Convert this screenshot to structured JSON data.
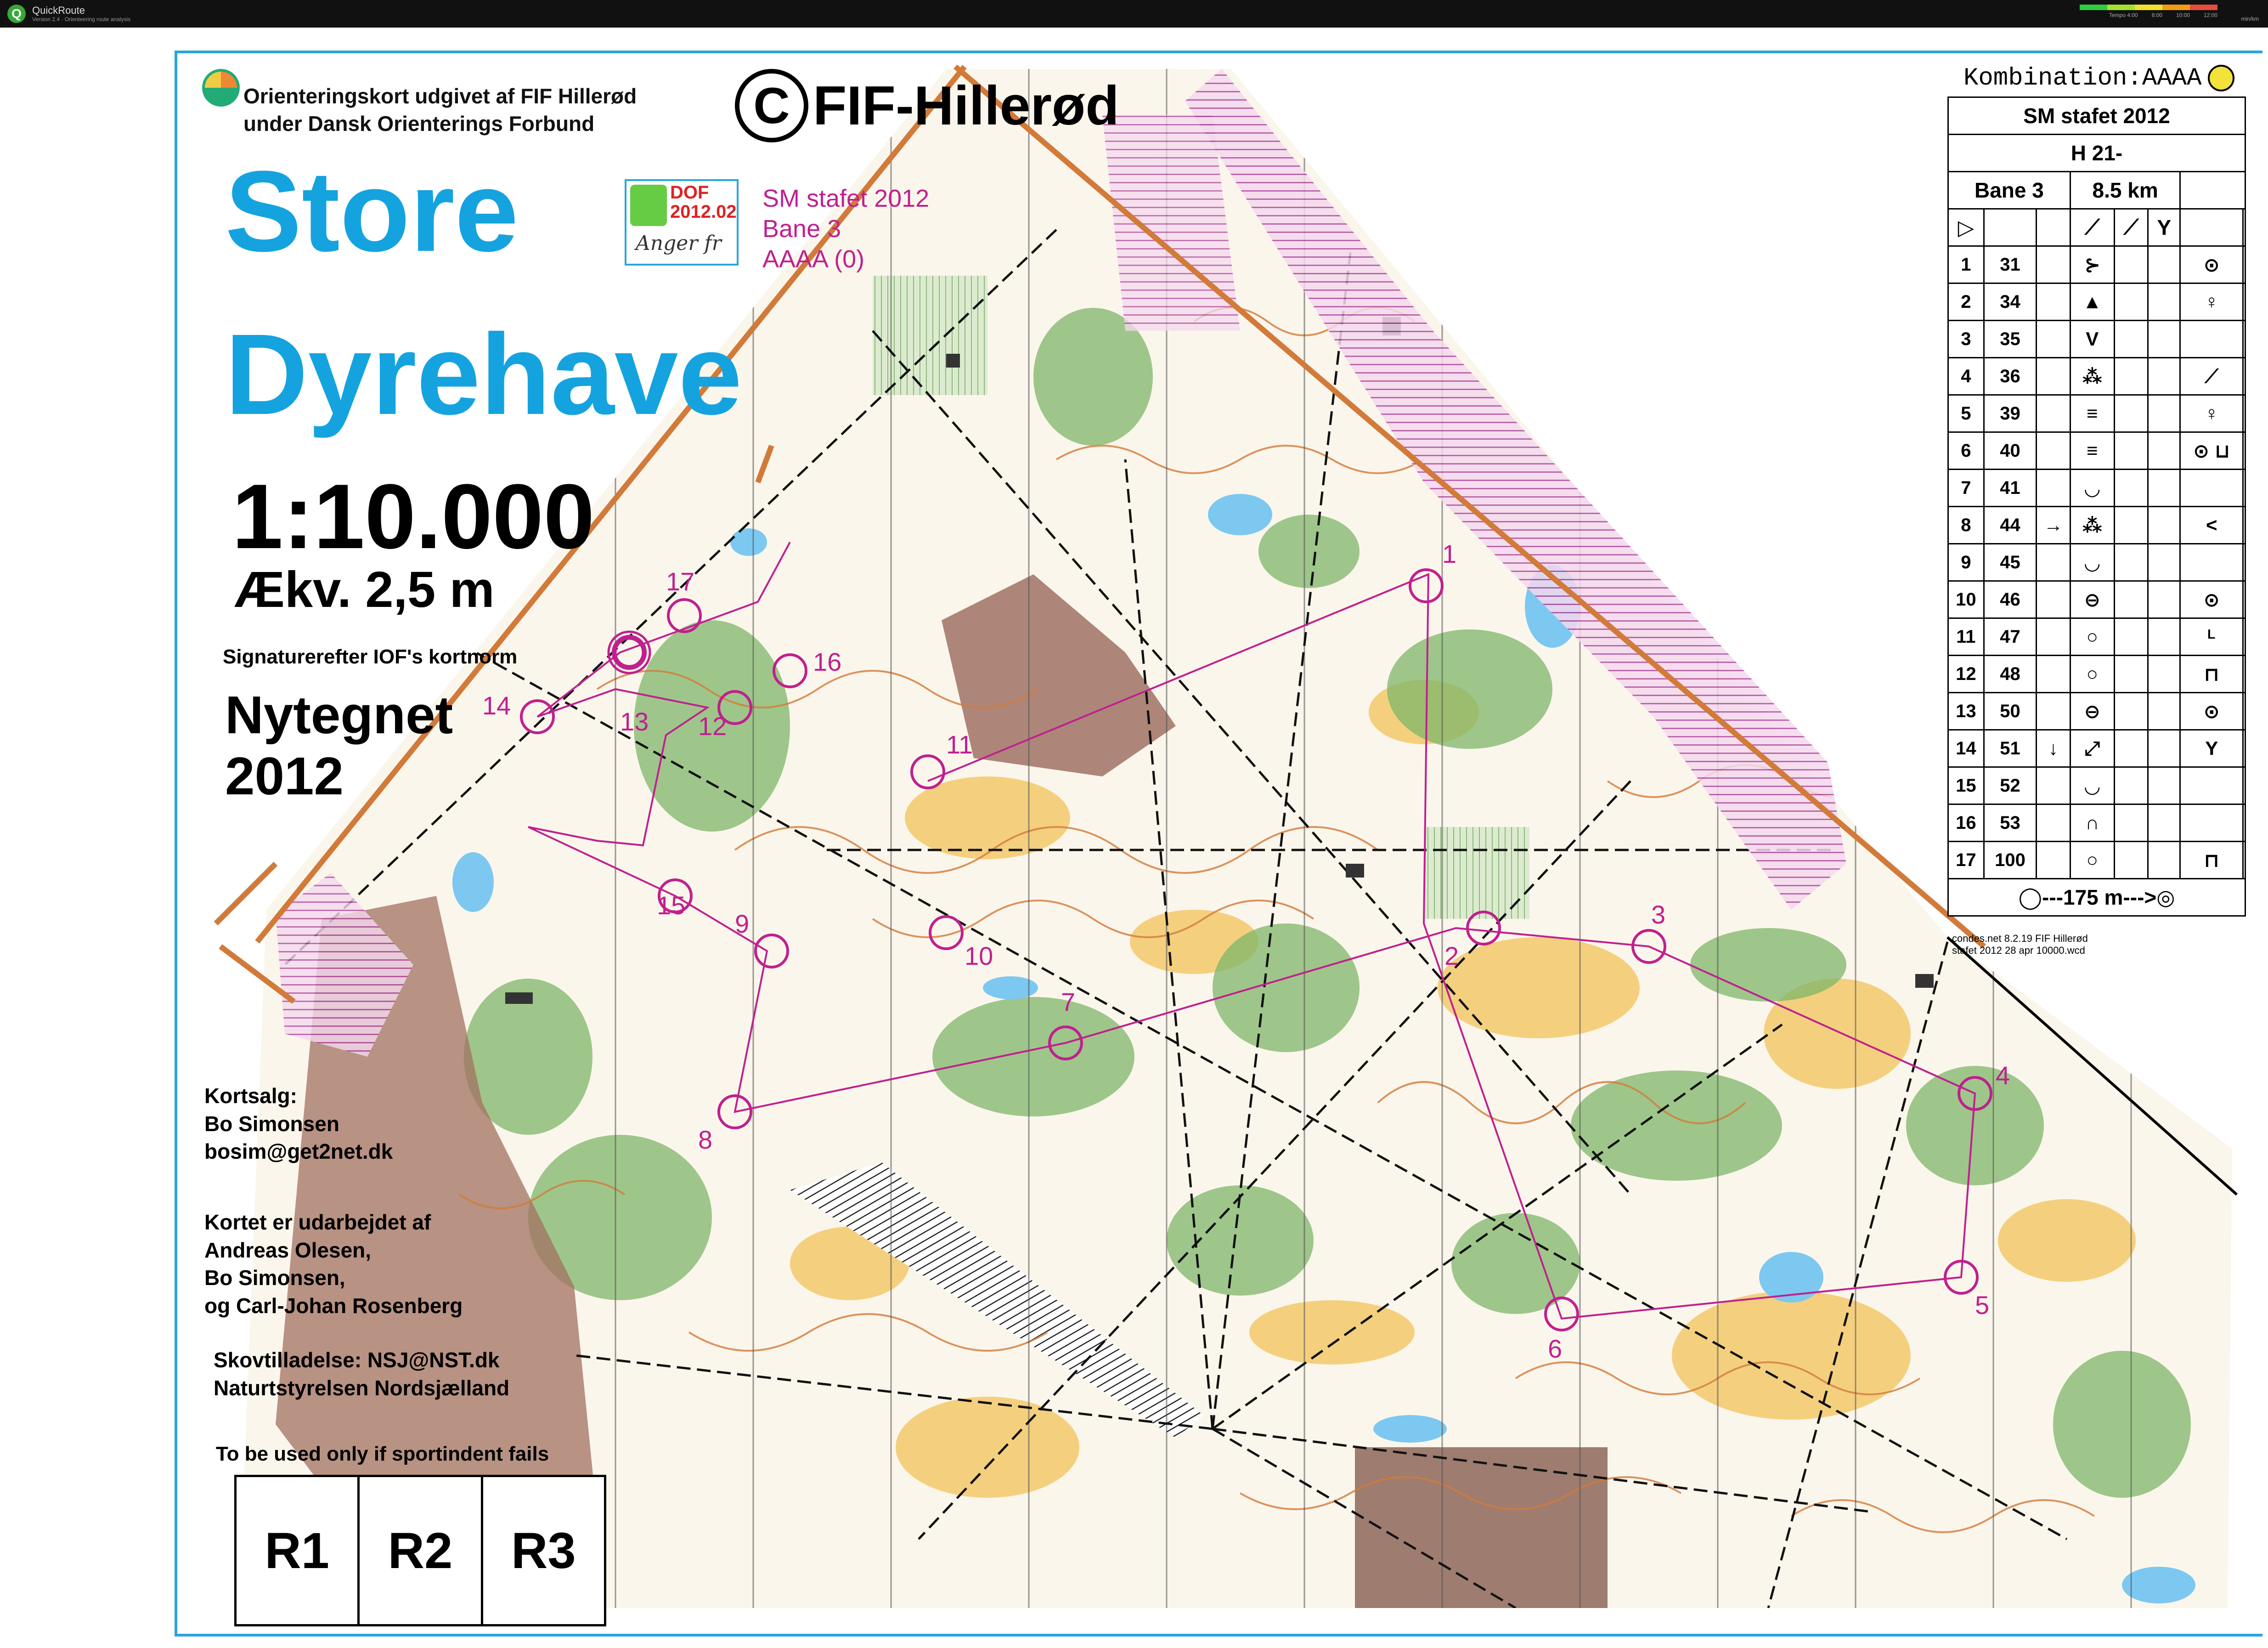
{
  "app": {
    "title": "QuickRoute",
    "subtitle": "Version 2.4 · Orienteering route analysis",
    "legend_ticks": [
      "Tempo 4:00",
      "8:00",
      "10:00",
      "12:00",
      "min/km"
    ]
  },
  "map": {
    "publisher_line1": "Orienteringskort udgivet af FIF Hillerød",
    "publisher_line2": "under Dansk Orienterings Forbund",
    "copyright_symbol": "C",
    "copyright_text": "FIF-Hillerød",
    "title_line1": "Store",
    "title_line2": "Dyrehave",
    "dof_code_line1": "DOF",
    "dof_code_line2": "2012.02",
    "dof_signature": "Anger fr",
    "event_line1": "SM stafet 2012",
    "event_line2": "Bane 3",
    "event_line3": "AAAA (0)",
    "scale": "1:10.000",
    "contour": "Ækv. 2,5 m",
    "norm": "Signaturerefter IOF's kortnorm",
    "redrawn_line1": "Nytegnet",
    "redrawn_line2": "2012",
    "sales_line1": "Kortsalg:",
    "sales_line2": "Bo Simonsen",
    "sales_line3": "bosim@get2net.dk",
    "made_line1": "Kortet er udarbejdet af",
    "made_line2": "Andreas Olesen,",
    "made_line3": "Bo Simonsen,",
    "made_line4": "og Carl-Johan Rosenberg",
    "permit_line1": "Skovtilladelse: NSJ@NST.dk",
    "permit_line2": "Naturtstyrelsen Nordsjælland",
    "fails_note": "To be used only if sportindent fails",
    "r1": "R1",
    "r2": "R2",
    "r3": "R3"
  },
  "course": {
    "kombination": "Kombination:AAAA",
    "event": "SM stafet 2012",
    "class": "H 21-",
    "course_name": "Bane 3",
    "length": "8.5 km",
    "finish": "◯---175 m--->◎",
    "footer_line1": "condes.net 8.2.19 FIF Hillerød",
    "footer_line2": "stafet 2012 28 apr 10000.wcd",
    "controls": [
      {
        "n": "1",
        "code": "31",
        "dir": "",
        "feature": "⊱",
        "det": "⊙"
      },
      {
        "n": "2",
        "code": "34",
        "dir": "",
        "feature": "▲",
        "det": "♀"
      },
      {
        "n": "3",
        "code": "35",
        "dir": "",
        "feature": "V",
        "det": ""
      },
      {
        "n": "4",
        "code": "36",
        "dir": "",
        "feature": "⁂",
        "det": "⟋"
      },
      {
        "n": "5",
        "code": "39",
        "dir": "",
        "feature": "≡",
        "det": "♀"
      },
      {
        "n": "6",
        "code": "40",
        "dir": "",
        "feature": "≡",
        "det": "⊙ ⊔"
      },
      {
        "n": "7",
        "code": "41",
        "dir": "",
        "feature": "◡",
        "det": ""
      },
      {
        "n": "8",
        "code": "44",
        "dir": "→",
        "feature": "⁂",
        "det": "<"
      },
      {
        "n": "9",
        "code": "45",
        "dir": "",
        "feature": "◡",
        "det": ""
      },
      {
        "n": "10",
        "code": "46",
        "dir": "",
        "feature": "⊖",
        "det": "⊙"
      },
      {
        "n": "11",
        "code": "47",
        "dir": "",
        "feature": "○",
        "det": "ᴸ"
      },
      {
        "n": "12",
        "code": "48",
        "dir": "",
        "feature": "○",
        "det": "⊓"
      },
      {
        "n": "13",
        "code": "50",
        "dir": "",
        "feature": "⊖",
        "det": "⊙"
      },
      {
        "n": "14",
        "code": "51",
        "dir": "↓",
        "feature": "⤢",
        "det": "Y"
      },
      {
        "n": "15",
        "code": "52",
        "dir": "",
        "feature": "◡",
        "det": ""
      },
      {
        "n": "16",
        "code": "53",
        "dir": "",
        "feature": "∩",
        "det": ""
      },
      {
        "n": "17",
        "code": "100",
        "dir": "",
        "feature": "○",
        "det": "⊓"
      }
    ]
  },
  "route_labels": [
    "1",
    "2",
    "3",
    "4",
    "5",
    "6",
    "7",
    "8",
    "9",
    "10",
    "11",
    "12",
    "13",
    "14",
    "15",
    "16",
    "17"
  ],
  "colors": {
    "course": "#c0208f",
    "title": "#15a3e0",
    "forest": "#5f9c4e",
    "open": "#f2c96b",
    "water": "#7cc8f0",
    "contour": "#d27a3a",
    "out_of_bounds": "#b04fa0"
  }
}
